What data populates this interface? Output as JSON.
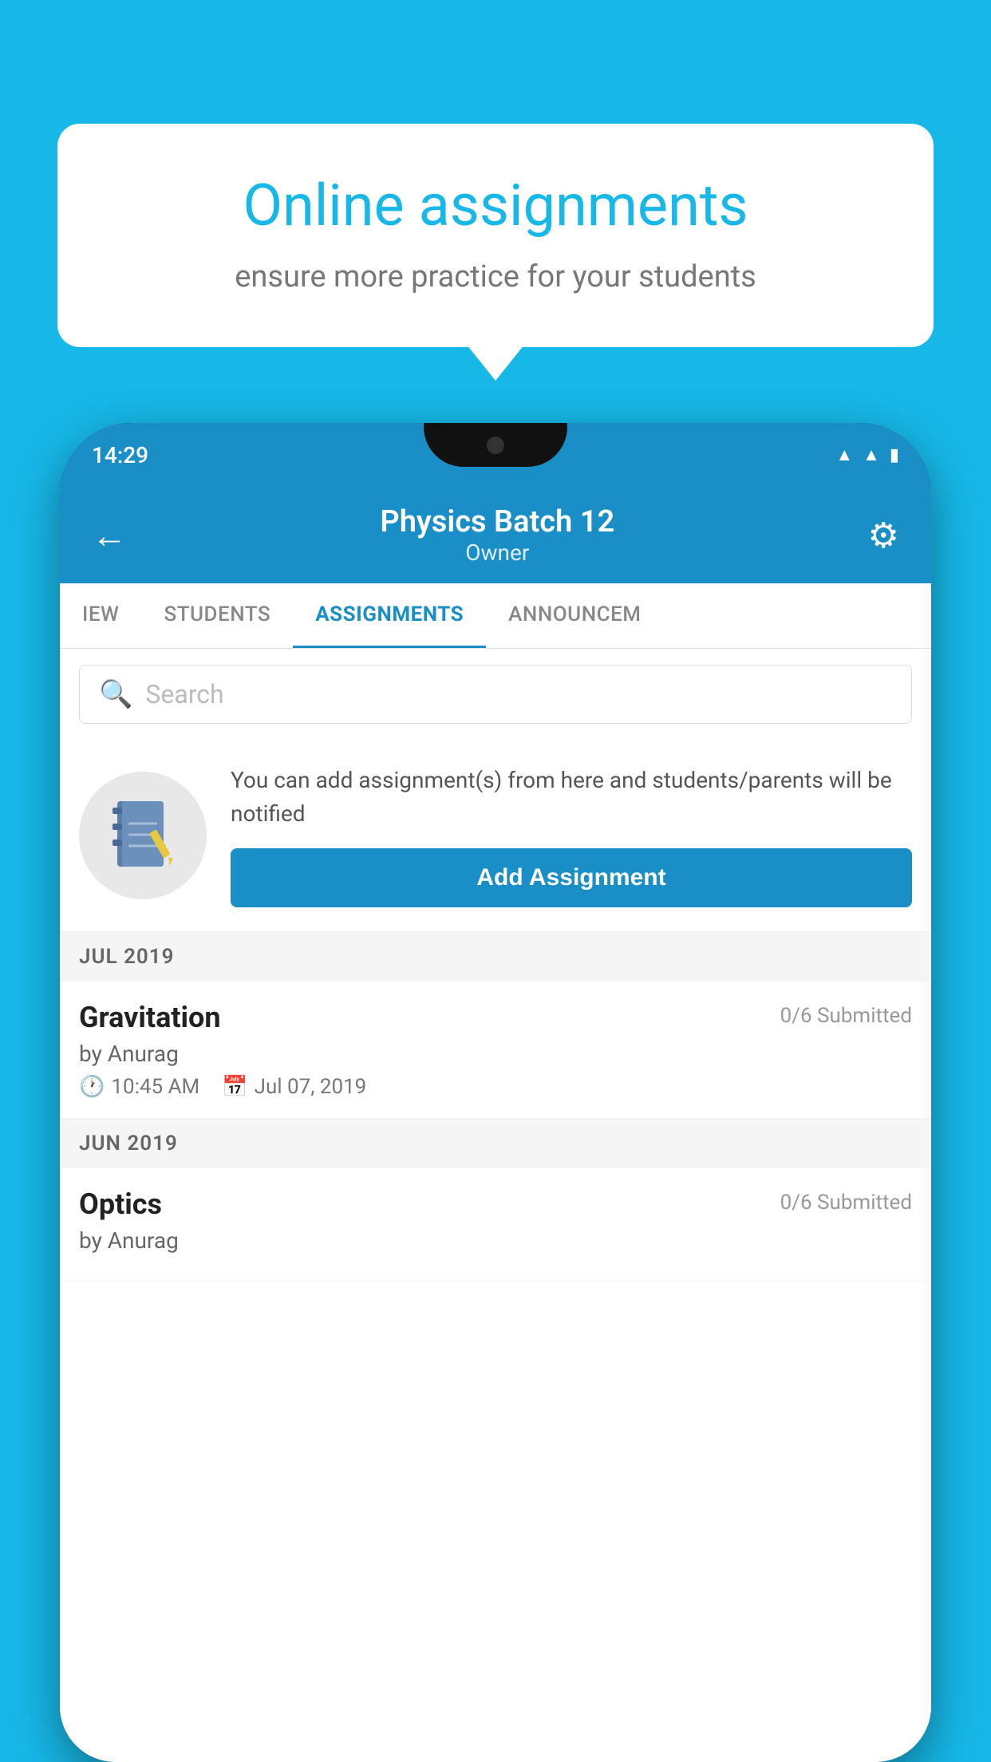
{
  "background_color": "#17b8e8",
  "speech_bubble": {
    "title": "Online assignments",
    "subtitle": "ensure more practice for your students"
  },
  "status_bar": {
    "time": "14:29",
    "icons": [
      "wifi",
      "signal",
      "battery"
    ]
  },
  "app_header": {
    "title": "Physics Batch 12",
    "subtitle": "Owner",
    "back_label": "←",
    "gear_label": "⚙"
  },
  "tabs": [
    {
      "label": "IEW",
      "active": false
    },
    {
      "label": "STUDENTS",
      "active": false
    },
    {
      "label": "ASSIGNMENTS",
      "active": true
    },
    {
      "label": "ANNOUNCEM",
      "active": false
    }
  ],
  "search": {
    "placeholder": "Search"
  },
  "promo": {
    "text": "You can add assignment(s) from here and students/parents will be notified",
    "button_label": "Add Assignment"
  },
  "sections": [
    {
      "label": "JUL 2019",
      "assignments": [
        {
          "title": "Gravitation",
          "submitted": "0/6 Submitted",
          "author": "by Anurag",
          "time": "10:45 AM",
          "date": "Jul 07, 2019"
        }
      ]
    },
    {
      "label": "JUN 2019",
      "assignments": [
        {
          "title": "Optics",
          "submitted": "0/6 Submitted",
          "author": "by Anurag",
          "time": "",
          "date": ""
        }
      ]
    }
  ]
}
